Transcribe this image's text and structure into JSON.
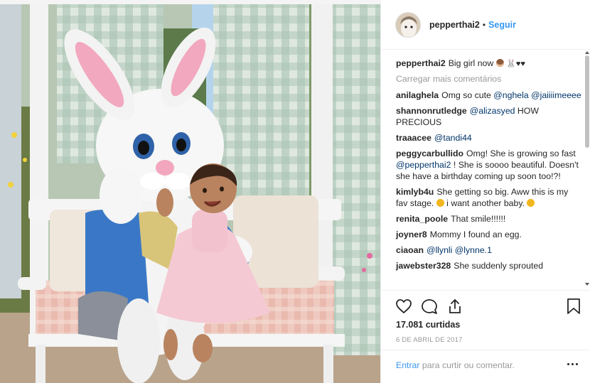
{
  "post": {
    "username": "pepperthai2",
    "follow_label": "Seguir",
    "separator": "•"
  },
  "caption": {
    "username": "pepperthai2",
    "text": "Big girl now",
    "emojis": [
      "monkey-face",
      "rabbit",
      "black-heart",
      "black-heart"
    ]
  },
  "load_more_label": "Carregar mais comentários",
  "comments": [
    {
      "user": "anilaghela",
      "text": "Omg so cute",
      "mention": "@nghela",
      "mention2": "@jaiiiimeeee",
      "tail": ""
    },
    {
      "user": "shannonrutledge",
      "text": "",
      "mention": "@alizasyed",
      "tail": "HOW PRECIOUS"
    },
    {
      "user": "traaacee",
      "text": "",
      "mention": "@tandi44",
      "tail": ""
    },
    {
      "user": "peggycarbullido",
      "text": "Omg! She is growing so fast",
      "mention": "@pepperthai2",
      "tail": "! She is soooo beautiful. Doesn't she have a birthday coming up soon too!?!"
    },
    {
      "user": "kimlyb4u",
      "text": "She getting so big. Aww this is my fav stage.",
      "tail": "i want another baby."
    },
    {
      "user": "renita_poole",
      "text": "That smile!!!!!!"
    },
    {
      "user": "joyner8",
      "text": "Mommy I found an egg."
    },
    {
      "user": "ciaoan",
      "mention": "@llynli",
      "mention2": "@lynne.1"
    },
    {
      "user": "jawebster328",
      "text": "She suddenly sprouted"
    }
  ],
  "likes_text": "17.081 curtidas",
  "date_text": "6 DE ABRIL DE 2017",
  "footer": {
    "login_label": "Entrar",
    "rest_text": "para curtir ou comentar."
  },
  "colors": {
    "link_blue": "#3897f0",
    "mention_blue": "#003569",
    "muted_gray": "#999999",
    "text": "#262626"
  },
  "icons": [
    "heart-icon",
    "comment-icon",
    "share-icon",
    "bookmark-icon",
    "more-options-icon"
  ]
}
